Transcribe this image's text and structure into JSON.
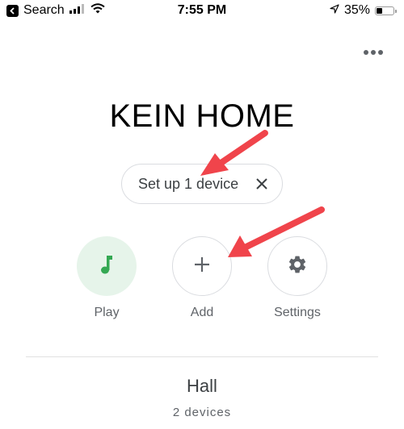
{
  "status_bar": {
    "back_label": "Search",
    "time": "7:55 PM",
    "battery_percent_label": "35%",
    "battery_level": 0.35
  },
  "header": {
    "more_icon": "more-horizontal-icon"
  },
  "home": {
    "title": "KEIN HOME"
  },
  "setup_chip": {
    "label": "Set up 1 device",
    "close_icon": "close-icon"
  },
  "actions": [
    {
      "label": "Play",
      "icon": "music-note-icon"
    },
    {
      "label": "Add",
      "icon": "plus-icon"
    },
    {
      "label": "Settings",
      "icon": "gear-icon"
    }
  ],
  "room": {
    "name": "Hall",
    "device_count": "2 devices"
  },
  "colors": {
    "accent_green": "#34a853",
    "play_bg": "#e6f4ea",
    "annotation_red": "#f0444b",
    "icon_gray": "#5f6368"
  }
}
